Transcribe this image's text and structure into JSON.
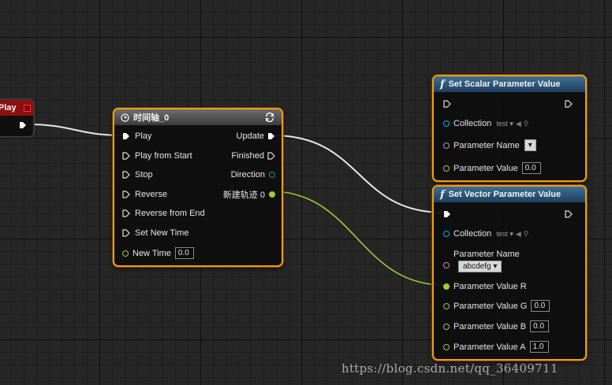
{
  "play_node": {
    "title": "Play"
  },
  "timeline_node": {
    "title": "时间轴_0",
    "inputs": [
      "Play",
      "Play from Start",
      "Stop",
      "Reverse",
      "Reverse from End",
      "Set New Time"
    ],
    "new_time_label": "New Time",
    "new_time_value": "0.0",
    "outputs": [
      "Update",
      "Finished",
      "Direction",
      "新建轨迹 0"
    ]
  },
  "scalar_node": {
    "title": "Set Scalar Parameter Value",
    "collection_label": "Collection",
    "collection_value": "test",
    "param_name_label": "Parameter Name",
    "param_value_label": "Parameter Value",
    "param_value": "0.0"
  },
  "vector_node": {
    "title": "Set Vector Parameter Value",
    "collection_label": "Collection",
    "collection_value": "test",
    "param_name_label": "Parameter Name",
    "param_name_value": "abcdefg",
    "r_label": "Parameter Value R",
    "g_label": "Parameter Value G",
    "g_value": "0.0",
    "b_label": "Parameter Value B",
    "b_value": "0.0",
    "a_label": "Parameter Value A",
    "a_value": "1.0"
  },
  "watermark": "https://blog.csdn.net/qq_36409711",
  "colors": {
    "node_border": "#f39c12",
    "exec_wire": "#ffffff",
    "float_pin": "#9acd32",
    "object_pin": "#00a8f3",
    "name_pin": "#c184e6",
    "direction_pin": "#119c86"
  }
}
